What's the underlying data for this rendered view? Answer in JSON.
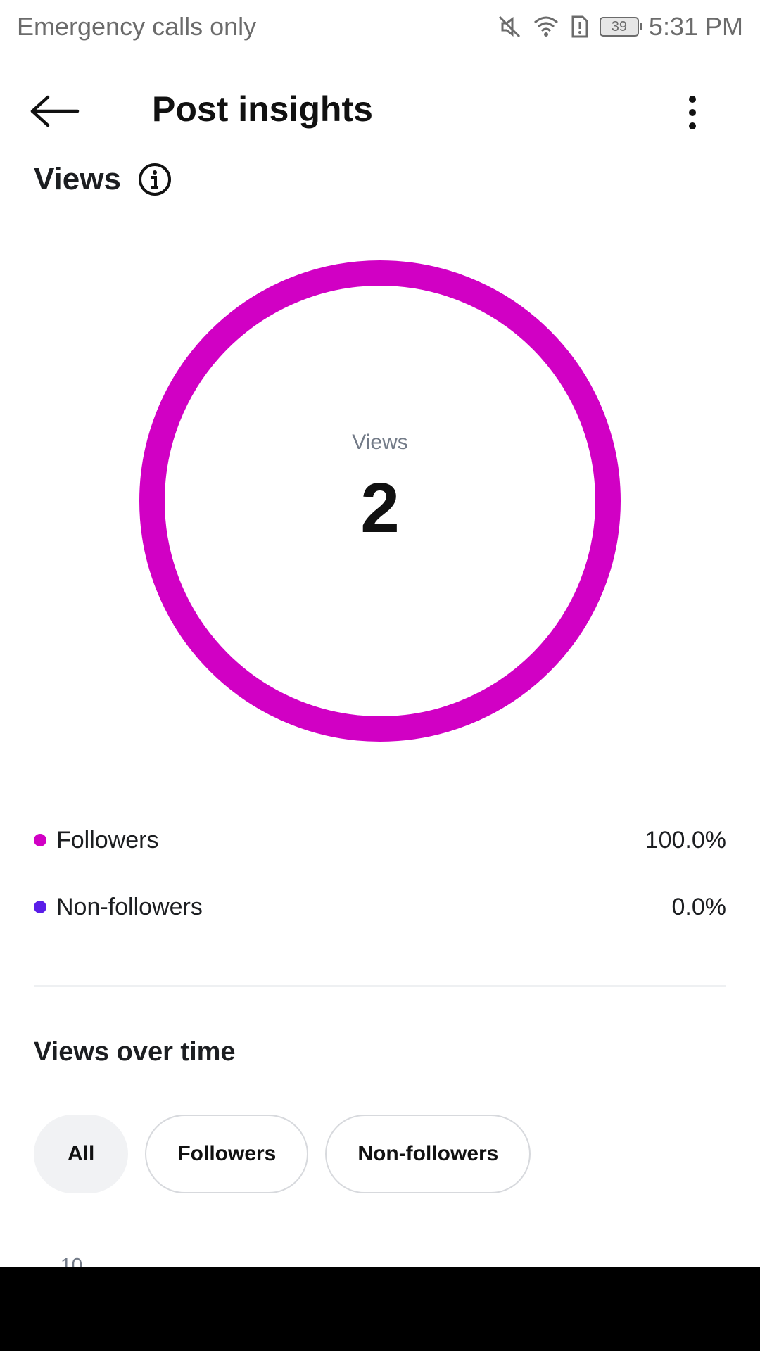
{
  "status_bar": {
    "carrier": "Emergency calls only",
    "battery": "39",
    "time": "5:31 PM"
  },
  "header": {
    "title": "Post insights"
  },
  "views_section": {
    "title": "Views",
    "center_label": "Views",
    "center_value": "2",
    "legend": [
      {
        "label": "Followers",
        "value": "100.0%",
        "color": "#d100c4"
      },
      {
        "label": "Non-followers",
        "value": "0.0%",
        "color": "#5a1de8"
      }
    ]
  },
  "chart_data": {
    "type": "pie",
    "categories": [
      "Followers",
      "Non-followers"
    ],
    "values": [
      100.0,
      0.0
    ],
    "colors": [
      "#d100c4",
      "#5a1de8"
    ],
    "title": "",
    "center_label": "Views",
    "center_value": 2
  },
  "views_over_time": {
    "title": "Views over time",
    "filters": [
      {
        "label": "All",
        "selected": true
      },
      {
        "label": "Followers",
        "selected": false
      },
      {
        "label": "Non-followers",
        "selected": false
      }
    ],
    "first_tick": "10"
  },
  "colors": {
    "accent": "#d100c4",
    "secondary": "#5a1de8"
  }
}
